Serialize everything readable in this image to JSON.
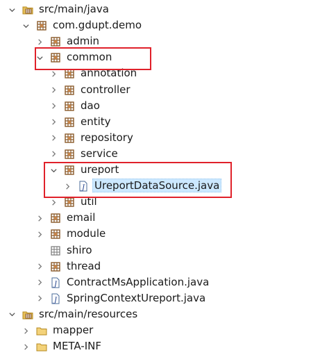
{
  "tree": {
    "rows": [
      {
        "label": "src/main/java",
        "depth": 0,
        "twisty": "expanded",
        "icon": "source-folder-icon"
      },
      {
        "label": "com.gdupt.demo",
        "depth": 1,
        "twisty": "expanded",
        "icon": "package-icon"
      },
      {
        "label": "admin",
        "depth": 2,
        "twisty": "collapsed",
        "icon": "package-icon"
      },
      {
        "label": "common",
        "depth": 2,
        "twisty": "expanded",
        "icon": "package-icon"
      },
      {
        "label": "annotation",
        "depth": 3,
        "twisty": "collapsed",
        "icon": "package-icon"
      },
      {
        "label": "controller",
        "depth": 3,
        "twisty": "collapsed",
        "icon": "package-icon"
      },
      {
        "label": "dao",
        "depth": 3,
        "twisty": "collapsed",
        "icon": "package-icon"
      },
      {
        "label": "entity",
        "depth": 3,
        "twisty": "collapsed",
        "icon": "package-icon"
      },
      {
        "label": "repository",
        "depth": 3,
        "twisty": "collapsed",
        "icon": "package-icon"
      },
      {
        "label": "service",
        "depth": 3,
        "twisty": "collapsed",
        "icon": "package-icon"
      },
      {
        "label": "ureport",
        "depth": 3,
        "twisty": "expanded",
        "icon": "package-icon"
      },
      {
        "label": "UreportDataSource.java",
        "depth": 4,
        "twisty": "collapsed",
        "icon": "java-file-icon",
        "selected": true
      },
      {
        "label": "util",
        "depth": 3,
        "twisty": "collapsed",
        "icon": "package-icon"
      },
      {
        "label": "email",
        "depth": 2,
        "twisty": "collapsed",
        "icon": "package-icon"
      },
      {
        "label": "module",
        "depth": 2,
        "twisty": "collapsed",
        "icon": "package-icon"
      },
      {
        "label": "shiro",
        "depth": 2,
        "twisty": "none",
        "icon": "empty-package-icon"
      },
      {
        "label": "thread",
        "depth": 2,
        "twisty": "collapsed",
        "icon": "package-icon"
      },
      {
        "label": "ContractMsApplication.java",
        "depth": 2,
        "twisty": "collapsed",
        "icon": "java-file-icon"
      },
      {
        "label": "SpringContextUreport.java",
        "depth": 2,
        "twisty": "collapsed",
        "icon": "java-file-icon"
      },
      {
        "label": "src/main/resources",
        "depth": 0,
        "twisty": "expanded",
        "icon": "source-folder-icon"
      },
      {
        "label": "mapper",
        "depth": 1,
        "twisty": "collapsed",
        "icon": "folder-icon"
      },
      {
        "label": "META-INF",
        "depth": 1,
        "twisty": "collapsed",
        "icon": "folder-icon"
      }
    ]
  },
  "colors": {
    "highlight_box": "#e0212a",
    "selection_bg": "#cce8ff",
    "package_brown": "#8a5a2b",
    "folder_yellow": "#e8c15a"
  }
}
